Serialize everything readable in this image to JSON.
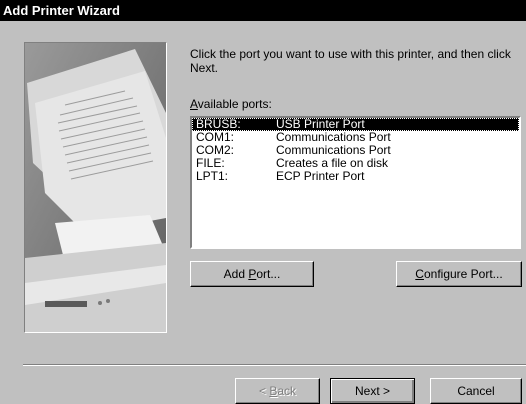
{
  "window": {
    "title": "Add Printer Wizard"
  },
  "instructions": "Click the port you want to use with this printer, and then click Next.",
  "available_ports": {
    "label_prefix": "",
    "label_accel": "A",
    "label_rest": "vailable ports:",
    "ports": [
      {
        "name": "BRUSB:",
        "description": "USB Printer Port",
        "selected": true
      },
      {
        "name": "COM1:",
        "description": "Communications Port",
        "selected": false
      },
      {
        "name": "COM2:",
        "description": "Communications Port",
        "selected": false
      },
      {
        "name": "FILE:",
        "description": "Creates a file on disk",
        "selected": false
      },
      {
        "name": "LPT1:",
        "description": "ECP Printer Port",
        "selected": false
      }
    ]
  },
  "buttons": {
    "add_port": {
      "prefix": "Add ",
      "accel": "P",
      "rest": "ort..."
    },
    "configure_port": {
      "prefix": "",
      "accel": "C",
      "rest": "onfigure Port..."
    },
    "back": {
      "prefix": "< ",
      "accel": "B",
      "rest": "ack",
      "enabled": false
    },
    "next": {
      "label": "Next >"
    },
    "cancel": {
      "label": "Cancel"
    }
  },
  "colors": {
    "title_bg": "#000000",
    "face": "#c0c0c0",
    "selection": "#000000"
  }
}
